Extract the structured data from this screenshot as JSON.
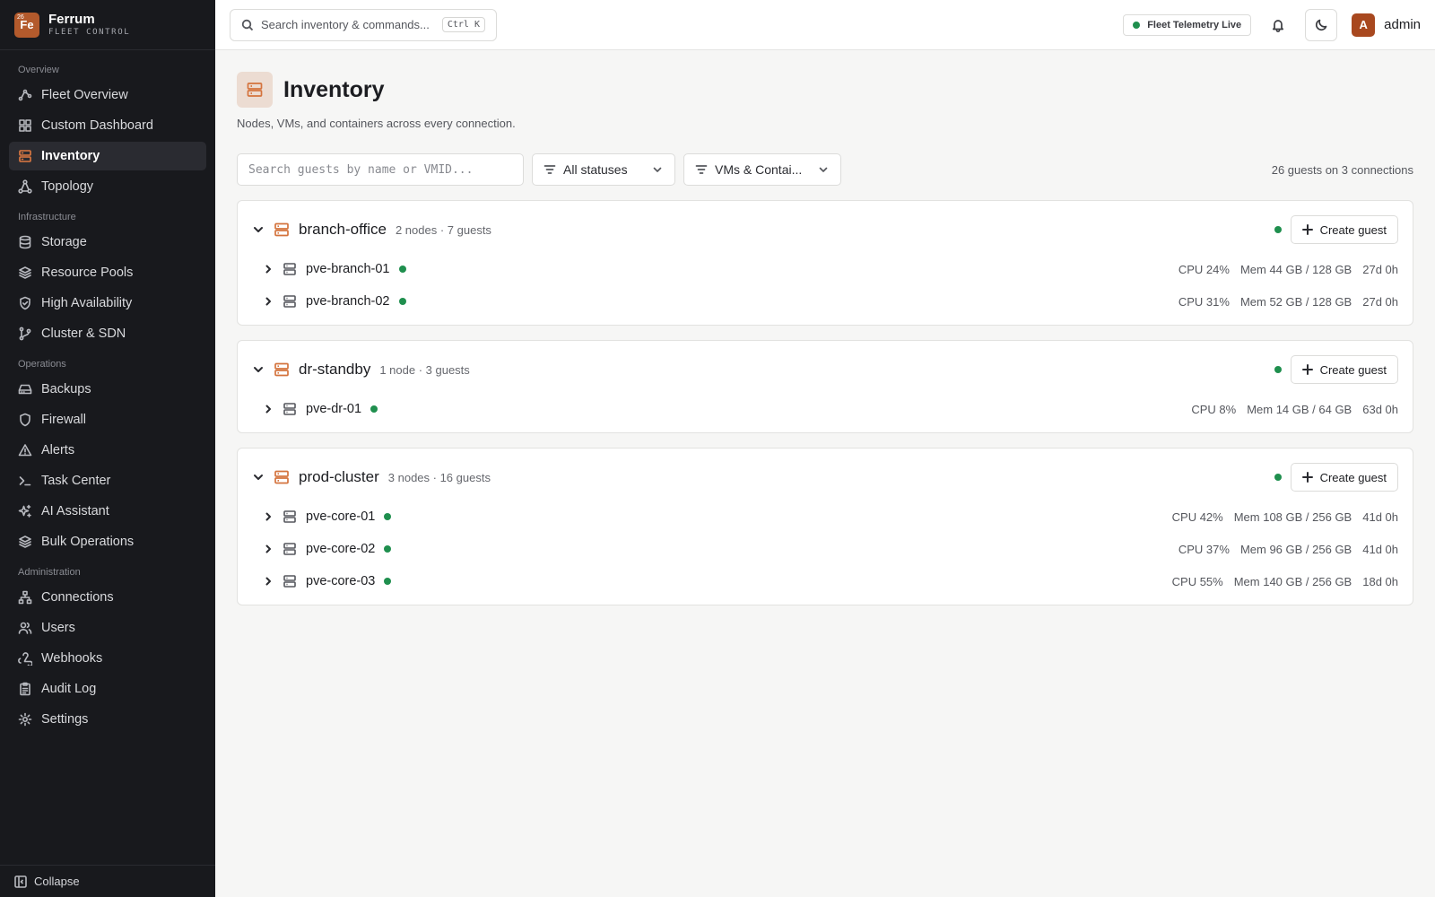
{
  "brand": {
    "logo_text": "Fe",
    "logo_sup": "26",
    "name": "Ferrum",
    "subtitle": "FLEET CONTROL"
  },
  "sidebar": {
    "sections": [
      {
        "title": "Overview",
        "items": [
          {
            "label": "Fleet Overview",
            "icon": "fleet-icon",
            "active": false
          },
          {
            "label": "Custom Dashboard",
            "icon": "dashboard-icon",
            "active": false
          },
          {
            "label": "Inventory",
            "icon": "server-icon",
            "active": true
          },
          {
            "label": "Topology",
            "icon": "topology-icon",
            "active": false
          }
        ]
      },
      {
        "title": "Infrastructure",
        "items": [
          {
            "label": "Storage",
            "icon": "database-icon"
          },
          {
            "label": "Resource Pools",
            "icon": "layers-icon"
          },
          {
            "label": "High Availability",
            "icon": "shield-check-icon"
          },
          {
            "label": "Cluster & SDN",
            "icon": "git-branch-icon"
          }
        ]
      },
      {
        "title": "Operations",
        "items": [
          {
            "label": "Backups",
            "icon": "hard-drive-icon"
          },
          {
            "label": "Firewall",
            "icon": "shield-icon"
          },
          {
            "label": "Alerts",
            "icon": "warning-icon"
          },
          {
            "label": "Task Center",
            "icon": "terminal-icon"
          },
          {
            "label": "AI Assistant",
            "icon": "sparkles-icon"
          },
          {
            "label": "Bulk Operations",
            "icon": "layers-icon"
          }
        ]
      },
      {
        "title": "Administration",
        "items": [
          {
            "label": "Connections",
            "icon": "network-icon"
          },
          {
            "label": "Users",
            "icon": "users-icon"
          },
          {
            "label": "Webhooks",
            "icon": "webhook-icon"
          },
          {
            "label": "Audit Log",
            "icon": "clipboard-icon"
          },
          {
            "label": "Settings",
            "icon": "gear-icon"
          }
        ]
      }
    ],
    "collapse_label": "Collapse"
  },
  "topbar": {
    "search_placeholder": "Search inventory & commands...",
    "search_shortcut": "Ctrl K",
    "telemetry_label": "Fleet Telemetry Live",
    "user_initial": "A",
    "user_name": "admin"
  },
  "page": {
    "title": "Inventory",
    "subtitle": "Nodes, VMs, and containers across every connection.",
    "guest_search_placeholder": "Search guests by name or VMID...",
    "status_filter": "All statuses",
    "type_filter": "VMs & Contai...",
    "count_summary": "26 guests on 3 connections",
    "create_label": "Create guest"
  },
  "clusters": [
    {
      "name": "branch-office",
      "meta": "2 nodes · 7 guests",
      "nodes": [
        {
          "name": "pve-branch-01",
          "cpu": "CPU 24%",
          "mem": "Mem 44 GB / 128 GB",
          "uptime": "27d 0h"
        },
        {
          "name": "pve-branch-02",
          "cpu": "CPU 31%",
          "mem": "Mem 52 GB / 128 GB",
          "uptime": "27d 0h"
        }
      ]
    },
    {
      "name": "dr-standby",
      "meta": "1 node · 3 guests",
      "nodes": [
        {
          "name": "pve-dr-01",
          "cpu": "CPU 8%",
          "mem": "Mem 14 GB / 64 GB",
          "uptime": "63d 0h"
        }
      ]
    },
    {
      "name": "prod-cluster",
      "meta": "3 nodes · 16 guests",
      "nodes": [
        {
          "name": "pve-core-01",
          "cpu": "CPU 42%",
          "mem": "Mem 108 GB / 256 GB",
          "uptime": "41d 0h"
        },
        {
          "name": "pve-core-02",
          "cpu": "CPU 37%",
          "mem": "Mem 96 GB / 256 GB",
          "uptime": "41d 0h"
        },
        {
          "name": "pve-core-03",
          "cpu": "CPU 55%",
          "mem": "Mem 140 GB / 256 GB",
          "uptime": "18d 0h"
        }
      ]
    }
  ],
  "colors": {
    "accent": "#d4733d",
    "status_ok": "#1f8f4e",
    "sidebar_bg": "#18191d"
  }
}
